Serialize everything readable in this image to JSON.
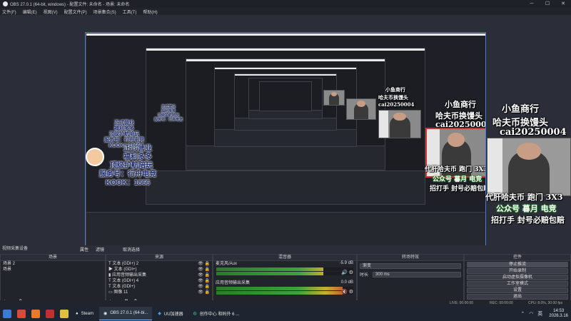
{
  "window": {
    "title": "OBS 27.0.1 (64-bit, windows) - 配置文件: 未命名 - 场景: 未命名"
  },
  "menu": [
    "文件(F)",
    "编辑(E)",
    "视图(V)",
    "配置文件(P)",
    "场景集合(S)",
    "工具(T)",
    "帮助(H)"
  ],
  "overlays": {
    "badge": {
      "lines": [
        "正式营业",
        "福利多多",
        "顶级护航陪玩",
        "服务号：行舟电竞",
        "KOOK：1866"
      ]
    },
    "shop": {
      "line1": "小鱼商行",
      "line2": "哈夫币换馒头",
      "line3": "cai20250004"
    },
    "promo": {
      "line1": "代肝哈夫币 跑门 3X3",
      "line2": "公众号 暮月 电竞",
      "line3": "招打手 封号必赔包赔"
    }
  },
  "docks": {
    "mixer_label": "视频采集设备",
    "scenes": {
      "title": "场景",
      "items": [
        "场景 2",
        "场景"
      ]
    },
    "sources": {
      "title": "来源",
      "items": [
        "文本 (GDI+) 2",
        "文本 (GDI+)",
        "应用音频输出采集",
        "文本 (GDI+) 4",
        "文本 (GDI+)",
        "图像 11"
      ]
    },
    "mixer": {
      "title": "混音器",
      "channels": [
        {
          "name": "麦克风/Aux",
          "db": "-5.9 dB",
          "level": 0.78
        },
        {
          "name": "应用音频输出采集",
          "db": "0.0 dB",
          "level": 0.92
        }
      ]
    },
    "transitions": {
      "title": "转场特效",
      "type": "渐变",
      "duration_label": "时长",
      "duration": "300 ms"
    },
    "controls": {
      "title": "控件",
      "buttons": [
        "停止推流",
        "开始录制",
        "启动虚拟摄像机",
        "工作室模式",
        "设置",
        "退出"
      ]
    },
    "tabs": {
      "properties": "属性",
      "filters": "滤镜",
      "cancel_select": "取消选择"
    }
  },
  "status": {
    "live": "LIVE: 00:00:00",
    "rec": "REC: 00:00:00",
    "cpu": "CPU: 8.0%, 30.00 fps"
  },
  "taskbar": {
    "tasks": [
      "Steam",
      "OBS 27.0.1 (64-bi...",
      "UU加速器",
      "创作中心 和码外 6 ..."
    ],
    "active_index": 1,
    "time": "14:53",
    "date": "2026.3.16",
    "ime": "英"
  },
  "colors": {
    "accent": "#2f62b8",
    "selection": "#4a7bd0",
    "bg": "#2b2e38"
  }
}
